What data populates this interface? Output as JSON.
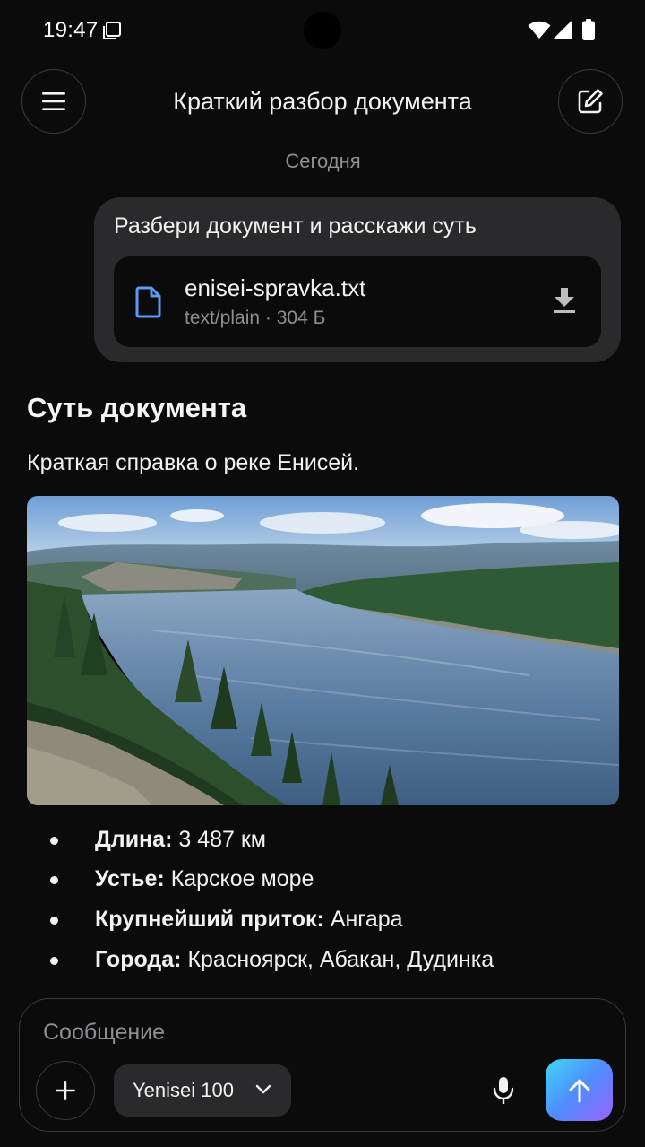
{
  "status_bar": {
    "time": "19:47"
  },
  "header": {
    "title": "Краткий разбор документа"
  },
  "chat": {
    "date_divider": "Сегодня",
    "user_message": {
      "text": "Разбери документ и расскажи суть",
      "attachment": {
        "file_name": "enisei-spravka.txt",
        "meta": "text/plain · 304 Б"
      }
    },
    "assistant_message": {
      "heading": "Суть документа",
      "intro": "Краткая справка о реке Енисей.",
      "image_subject": "river-landscape",
      "facts": [
        {
          "label": "Длина:",
          "value": "3 487 км"
        },
        {
          "label": "Устье:",
          "value": "Карское море"
        },
        {
          "label": "Крупнейший приток:",
          "value": "Ангара"
        },
        {
          "label": "Города:",
          "value": "Красноярск, Абакан, Дудинка"
        }
      ]
    }
  },
  "composer": {
    "placeholder": "Сообщение",
    "value": "",
    "model": "Yenisei 100"
  },
  "colors": {
    "background": "#0b0b0c",
    "bubble": "#2a2a2c",
    "file_icon": "#5b9cf5",
    "send_gradient": [
      "#3fd6f6",
      "#4f8cff",
      "#9b63ff"
    ]
  }
}
